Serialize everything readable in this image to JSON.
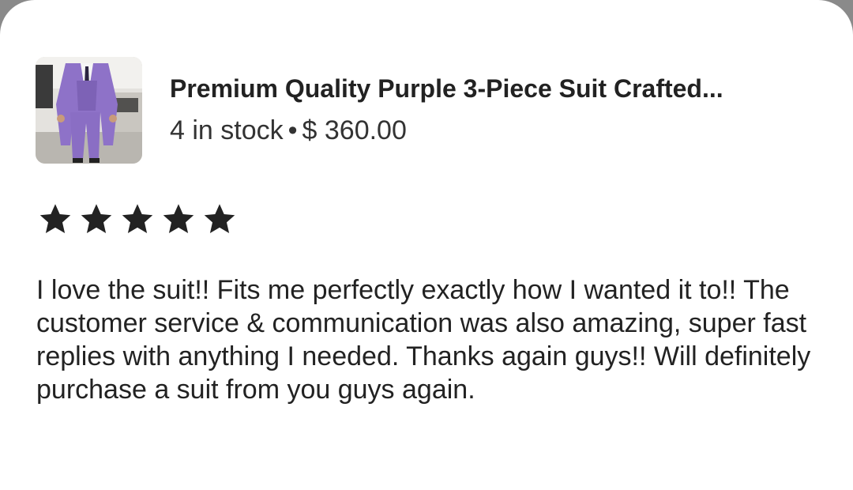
{
  "listing": {
    "image_icon": "product-photo-purple-suit",
    "title": "Premium Quality Purple 3-Piece Suit  Crafted...",
    "stock": "4 in stock",
    "separator": "•",
    "price": "$ 360.00"
  },
  "rating": {
    "stars": 5,
    "max": 5,
    "star_color": "#222222"
  },
  "review": {
    "text": "I love the suit!! Fits me perfectly exactly how I wanted it to!! The customer service & communication was also amazing, super fast replies with anything I needed. Thanks again guys!! Will definitely purchase a suit from you guys again."
  }
}
